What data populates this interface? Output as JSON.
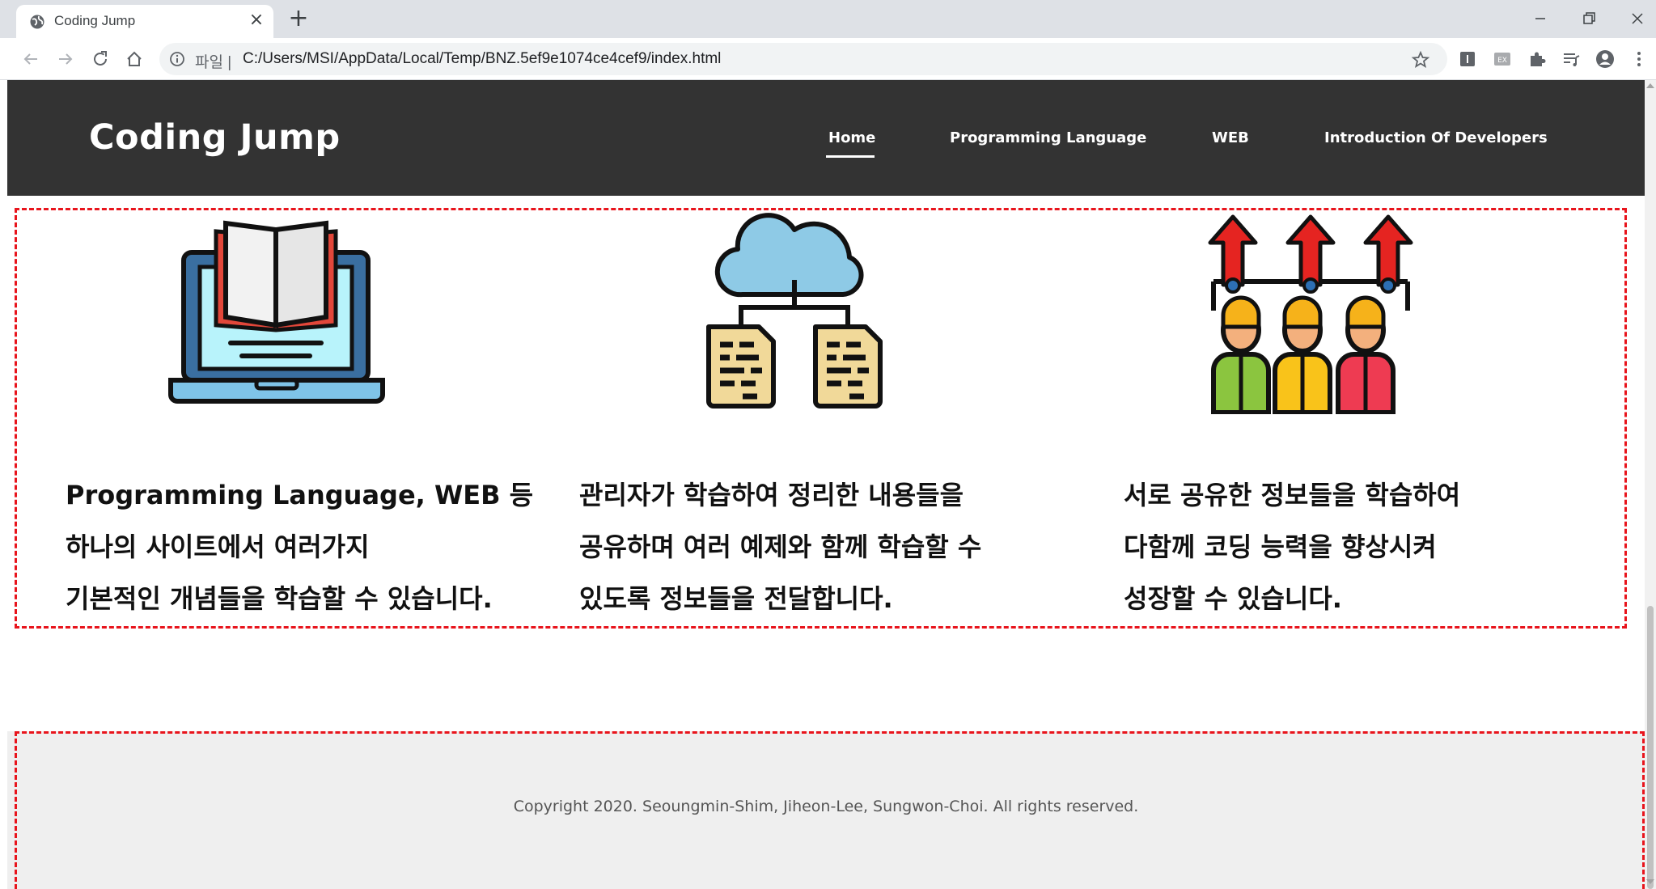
{
  "browser": {
    "tab_title": "Coding Jump",
    "scheme_label": "파일 |",
    "url": "C:/Users/MSI/AppData/Local/Temp/BNZ.5ef9e1074ce4cef9/index.html"
  },
  "site": {
    "brand": "Coding Jump",
    "nav": [
      {
        "label": "Home",
        "active": true
      },
      {
        "label": "Programming Language",
        "active": false
      },
      {
        "label": "WEB",
        "active": false
      },
      {
        "label": "Introduction Of Developers",
        "active": false
      }
    ]
  },
  "features": [
    {
      "icon": "laptop-book-icon",
      "lines": [
        "Programming Language, WEB 등",
        "하나의 사이트에서 여러가지",
        "기본적인 개념들을 학습할 수 있습니다."
      ]
    },
    {
      "icon": "cloud-documents-icon",
      "lines": [
        "관리자가 학습하여 정리한 내용들을",
        "공유하며 여러 예제와 함께 학습할 수",
        "있도록 정보들을 전달합니다."
      ]
    },
    {
      "icon": "team-growth-icon",
      "lines": [
        "서로 공유한 정보들을 학습하여",
        "다함께 코딩 능력을 향상시켜",
        "성장할 수 있습니다."
      ]
    }
  ],
  "footer": {
    "copyright": "Copyright 2020. Seoungmin-Shim, Jiheon-Lee, Sungwon-Choi. All rights reserved."
  },
  "colors": {
    "header_bg": "#333333",
    "dashed_border": "#e8141c",
    "footer_bg": "#efefef"
  }
}
